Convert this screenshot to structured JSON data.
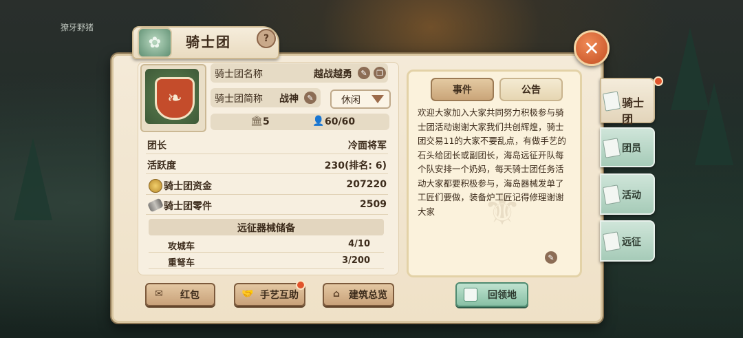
{
  "background": {
    "labels": [
      "獠牙野猪"
    ]
  },
  "header": {
    "title": "骑士团",
    "help_label": "?",
    "close_label": "✕"
  },
  "guild": {
    "name_label": "骑士团名称",
    "name_value": "越战越勇",
    "short_label": "骑士团简称",
    "short_value": "战神",
    "status_value": "休闲",
    "level": "5",
    "members": "60/60"
  },
  "stats": [
    {
      "key": "团长",
      "value": "冷面将军"
    },
    {
      "key": "活跃度",
      "value": "230(排名: 6)"
    },
    {
      "key": "骑士团资金",
      "value": "207220",
      "icon": "coin-icon"
    },
    {
      "key": "骑士团零件",
      "value": "2509",
      "icon": "parts-icon"
    }
  ],
  "siege": {
    "title": "远征器械储备",
    "rows": [
      {
        "key": "攻城车",
        "value": "4/10"
      },
      {
        "key": "重弩车",
        "value": "3/200"
      }
    ]
  },
  "notice": {
    "tabs": [
      "事件",
      "公告"
    ],
    "active_tab": "公告",
    "text": "欢迎大家加入大家共同努力积极参与骑士团活动谢谢大家我们共创辉煌，骑士团交易11的大家不要乱点，有做手艺的石头给团长或副团长，海岛远征开队每个队安排一个奶妈，每天骑士团任务活动大家都要积极参与，海岛器械发单了工匠们要做，装备炉工匠记得修理谢谢大家"
  },
  "buttons": {
    "red_packet": "红包",
    "craft_help": "手艺互助",
    "buildings": "建筑总览",
    "return_territory": "回领地"
  },
  "side_tabs": [
    "骑士团",
    "团员",
    "活动",
    "远征"
  ],
  "colors": {
    "accent_red": "#e1542c",
    "panel_parchment": "#f4ead8",
    "tab_green": "#a6cbb8"
  }
}
